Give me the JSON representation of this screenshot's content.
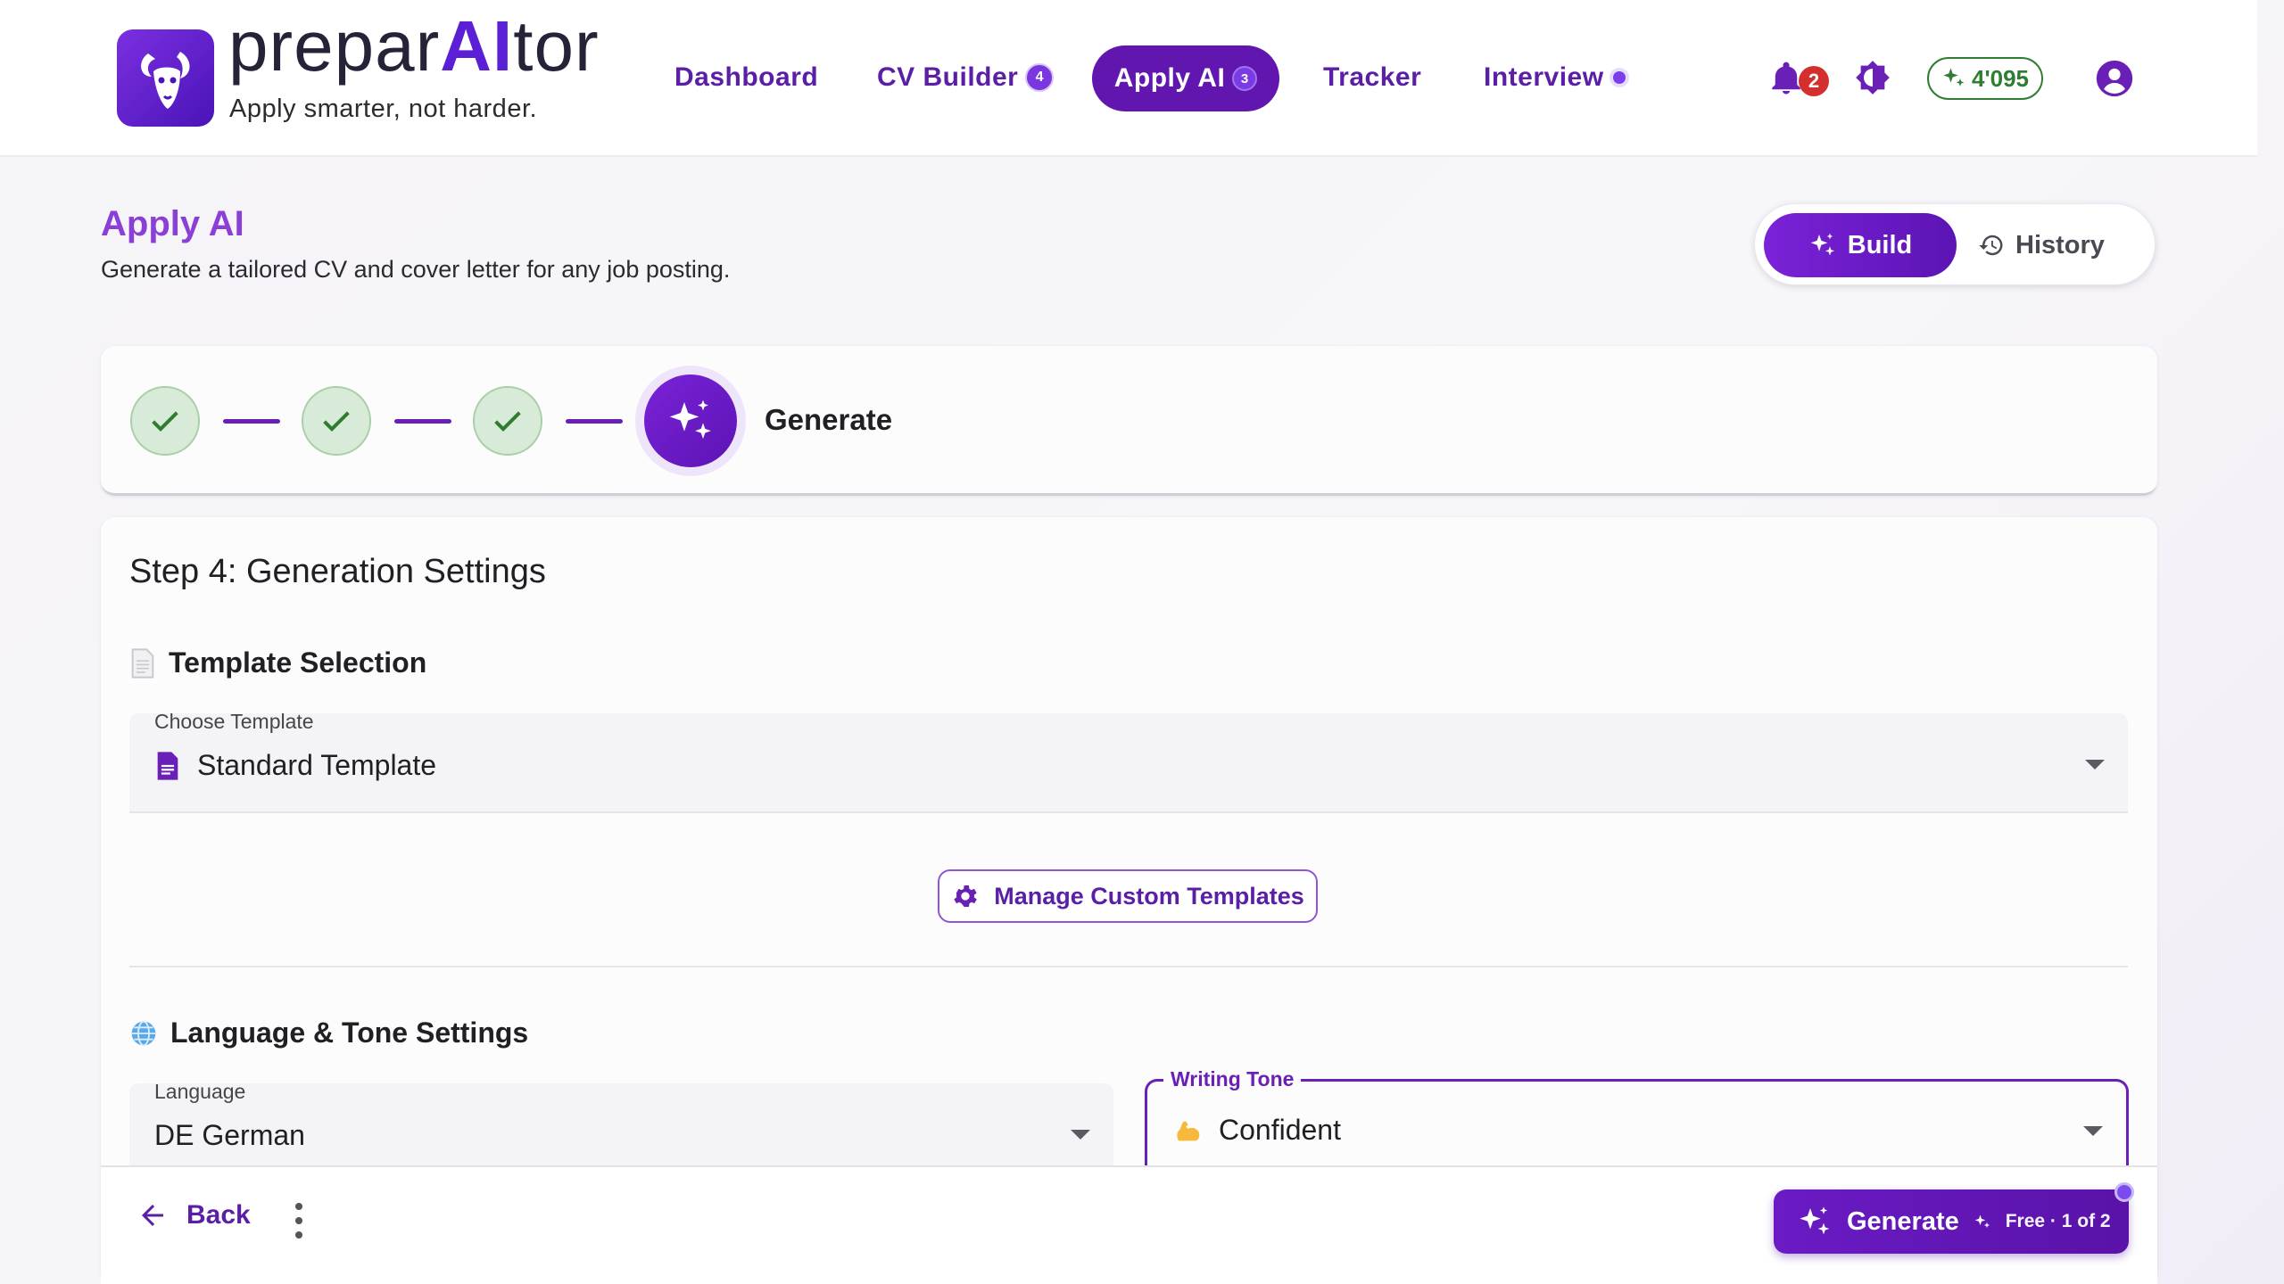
{
  "brand": {
    "name_prefix": "prepar",
    "name_ai": "AI",
    "name_suffix": "tor",
    "tagline": "Apply smarter, not harder."
  },
  "nav": {
    "items": [
      {
        "label": "Dashboard"
      },
      {
        "label": "CV Builder",
        "badge": "4"
      },
      {
        "label": "Apply AI",
        "badge": "3",
        "active": true
      },
      {
        "label": "Tracker"
      },
      {
        "label": "Interview"
      }
    ],
    "notifications_count": "2",
    "credits": "4'095"
  },
  "page": {
    "title": "Apply AI",
    "subtitle": "Generate a tailored CV and cover letter for any job posting."
  },
  "mode_toggle": {
    "build_label": "Build",
    "history_label": "History",
    "active": "build"
  },
  "stepper": {
    "completed_steps": 3,
    "current_label": "Generate"
  },
  "settings": {
    "title": "Step 4: Generation Settings",
    "template_section": {
      "heading": "Template Selection",
      "field_label": "Choose Template",
      "value": "Standard Template",
      "manage_label": "Manage Custom Templates"
    },
    "language_section": {
      "heading": "Language & Tone Settings",
      "language_label": "Language",
      "language_value": "DE German",
      "tone_label": "Writing Tone",
      "tone_value": "Confident"
    }
  },
  "footer": {
    "back_label": "Back",
    "generate_label": "Generate",
    "generate_meta": "Free · 1 of 2"
  },
  "colors": {
    "brand": "#5b1fd6",
    "primary": "#6216b0",
    "success": "#2e7d32",
    "alert": "#d32f2f"
  }
}
